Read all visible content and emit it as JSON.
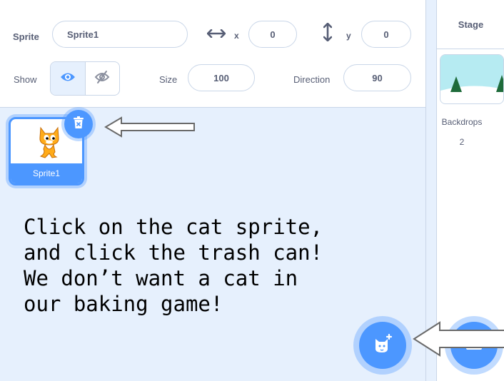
{
  "sprite_info": {
    "sprite_label": "Sprite",
    "sprite_name": "Sprite1",
    "x_label": "x",
    "x_value": "0",
    "y_label": "y",
    "y_value": "0",
    "show_label": "Show",
    "size_label": "Size",
    "size_value": "100",
    "direction_label": "Direction",
    "direction_value": "90"
  },
  "sprite_list": {
    "items": [
      {
        "name": "Sprite1"
      }
    ]
  },
  "instruction_text": "Click on the cat sprite,\nand click the trash can!\nWe don’t want a cat in\nour baking game!",
  "stage": {
    "title": "Stage",
    "backdrops_label": "Backdrops",
    "backdrops_count": "2"
  },
  "colors": {
    "accent": "#4c97ff",
    "panel_bg": "#e6f0fd",
    "text": "#575e75"
  },
  "icons": [
    "eye-icon",
    "eye-off-icon",
    "horizontal-arrows-icon",
    "vertical-arrows-icon",
    "trash-icon",
    "add-sprite-icon",
    "left-arrow-icon"
  ]
}
